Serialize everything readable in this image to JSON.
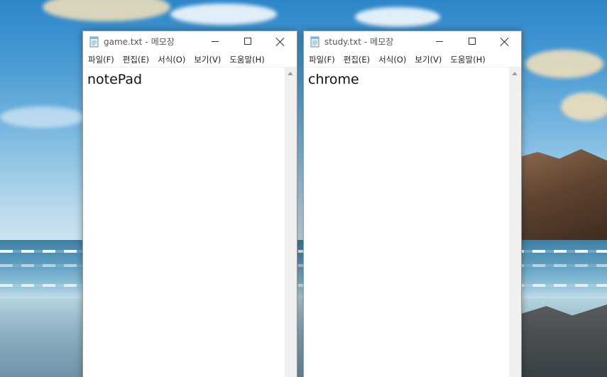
{
  "desktop": {
    "wallpaper": "beach-sky-wallpaper"
  },
  "windows": [
    {
      "title_file": "game.txt",
      "title_app": "메모장",
      "title_sep": "-",
      "menu": [
        "파일(F)",
        "편집(E)",
        "서식(O)",
        "보기(V)",
        "도움말(H)"
      ],
      "content": "notePad",
      "icons": {
        "app": "notepad-icon",
        "minimize": "minimize-icon",
        "maximize": "maximize-icon",
        "close": "close-icon",
        "scroll_up": "scroll-up-arrow-icon"
      }
    },
    {
      "title_file": "study.txt",
      "title_app": "메모장",
      "title_sep": "-",
      "menu": [
        "파일(F)",
        "편집(E)",
        "서식(O)",
        "보기(V)",
        "도움말(H)"
      ],
      "content": "chrome",
      "icons": {
        "app": "notepad-icon",
        "minimize": "minimize-icon",
        "maximize": "maximize-icon",
        "close": "close-icon",
        "scroll_up": "scroll-up-arrow-icon"
      }
    }
  ],
  "colors": {
    "window_bg": "#ffffff",
    "title_text": "#555555",
    "scrollbar_track": "#f0f0f0"
  }
}
